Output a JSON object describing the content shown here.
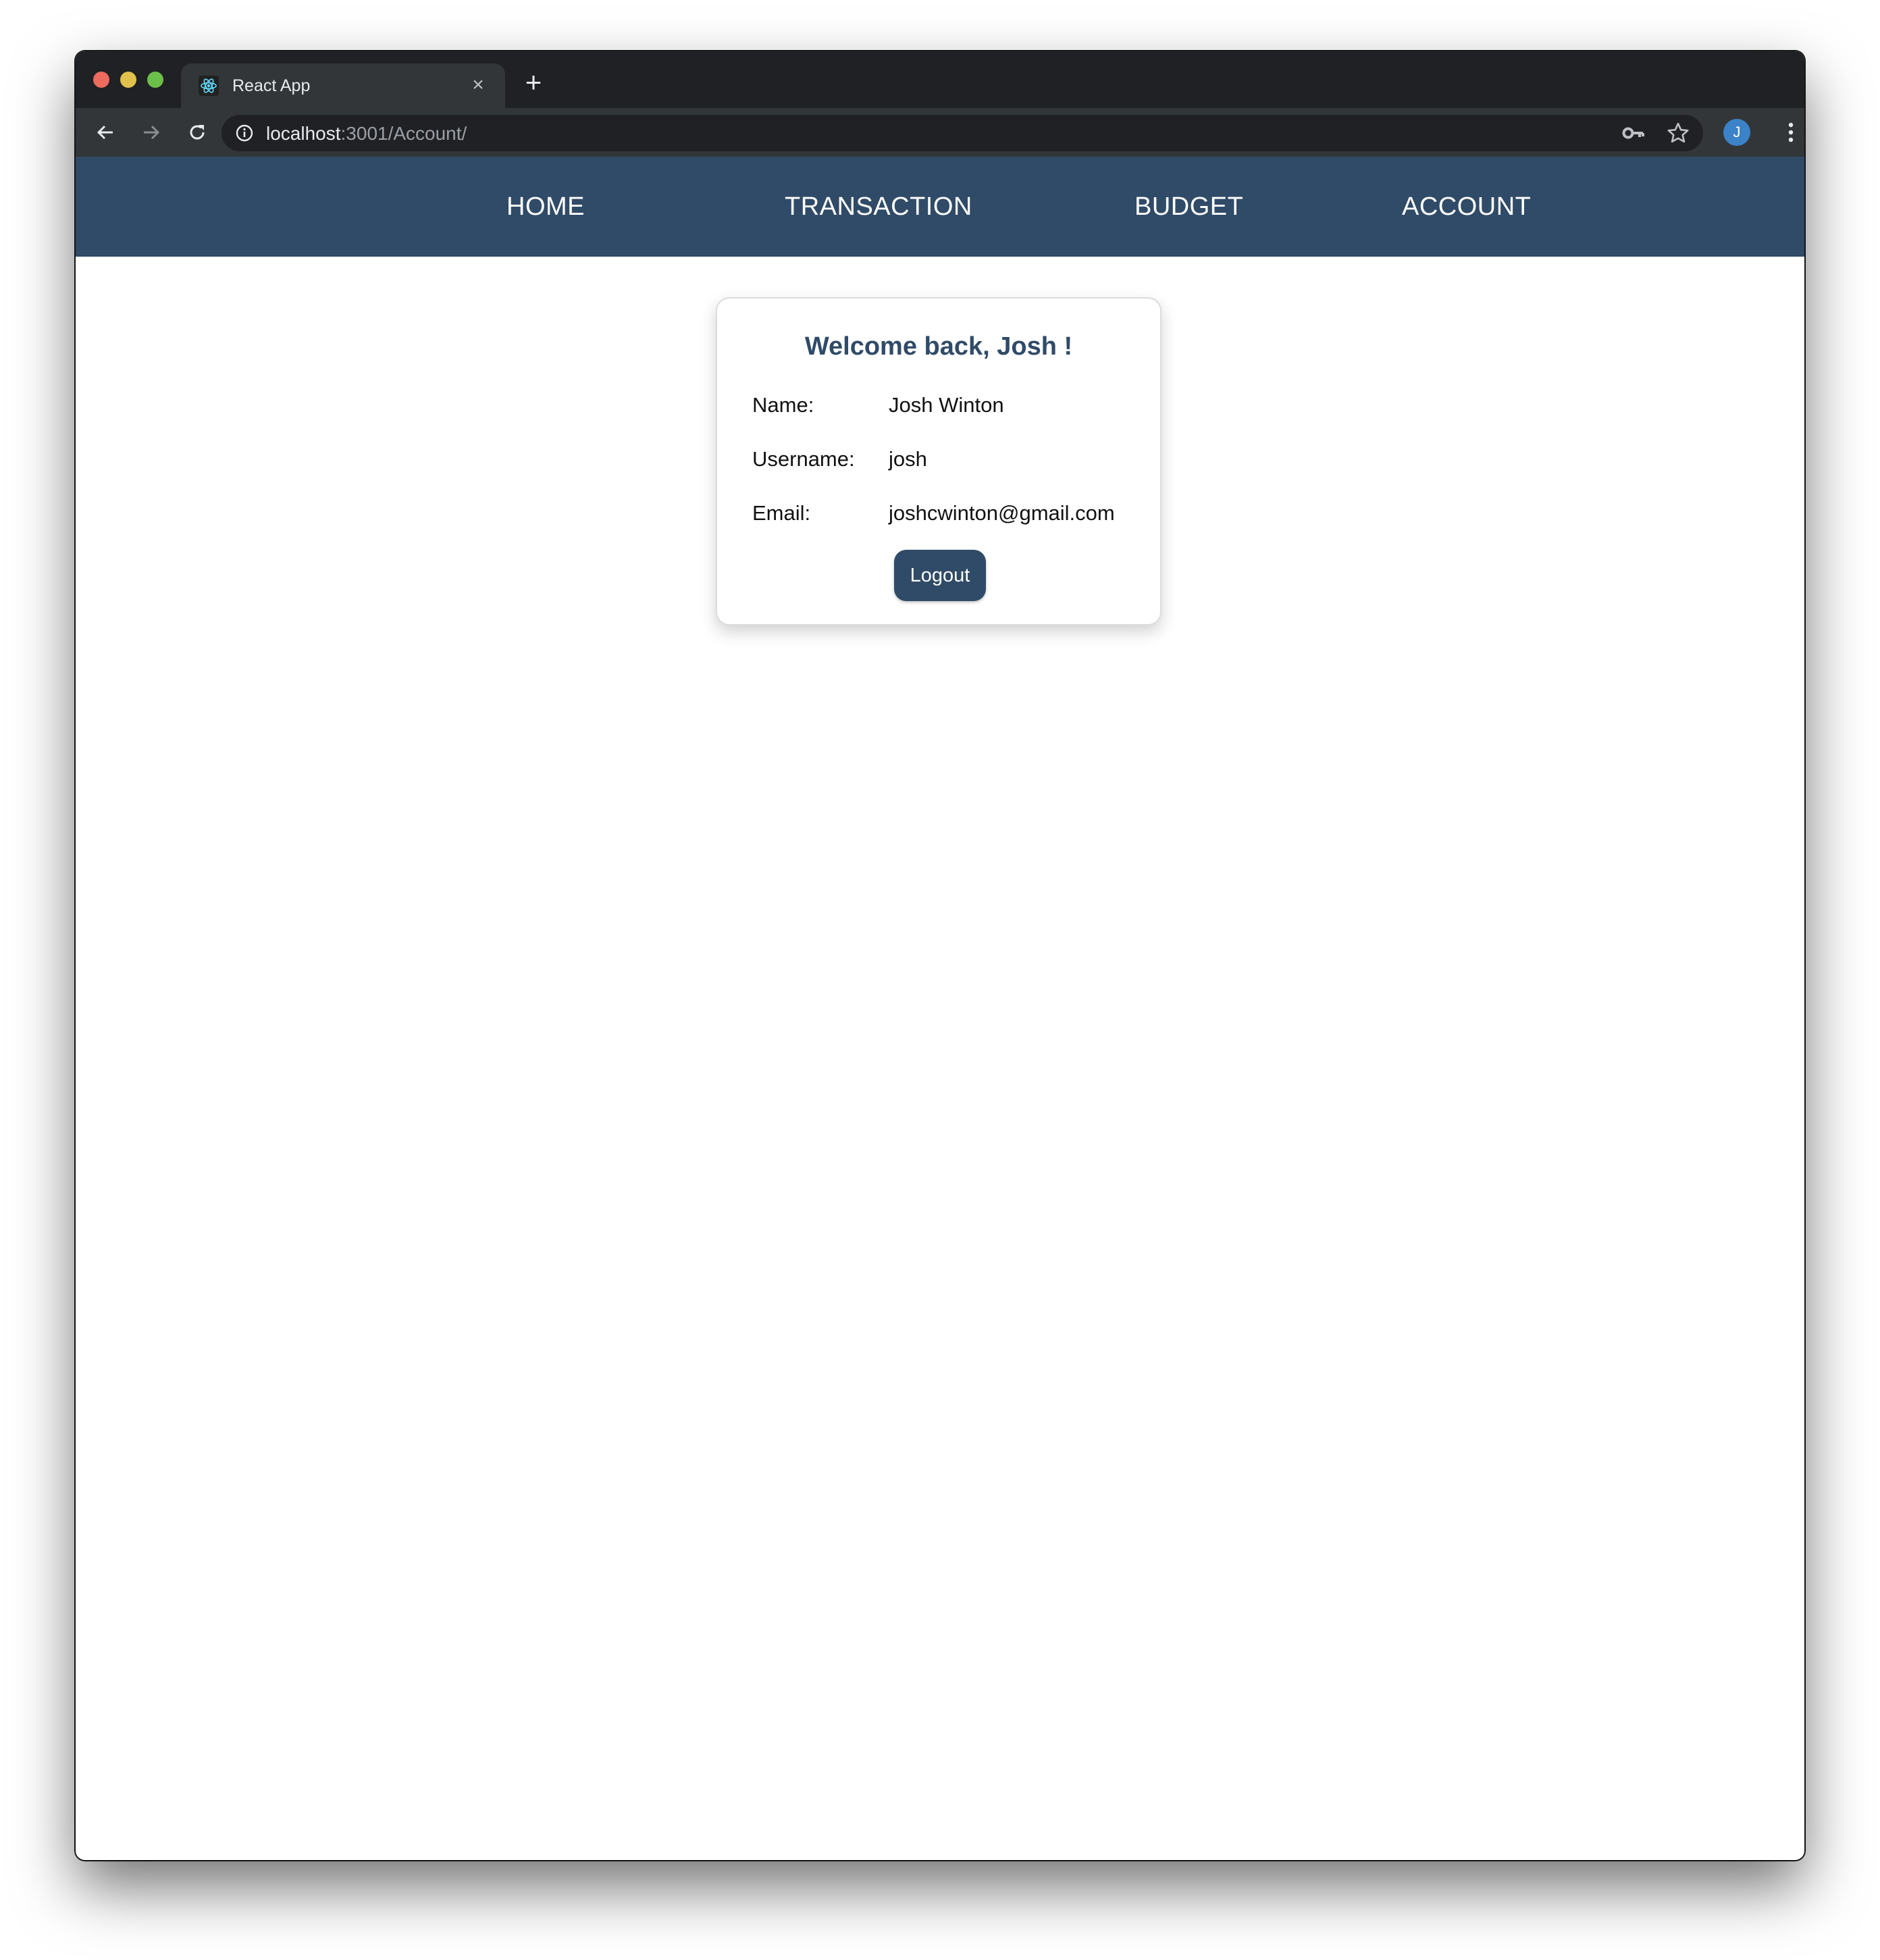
{
  "browser": {
    "tab_title": "React App",
    "url_host": "localhost",
    "url_rest": ":3001/Account/",
    "profile_initial": "J",
    "icons": {
      "favicon": "react-logo-icon",
      "close": "close-icon",
      "new_tab": "plus-icon",
      "back": "arrow-left-icon",
      "forward": "arrow-right-icon",
      "reload": "reload-icon",
      "site_info": "info-icon",
      "passwords": "key-icon",
      "bookmark": "star-icon",
      "menu": "vertical-dots-icon"
    }
  },
  "nav": {
    "items": [
      {
        "label": "HOME"
      },
      {
        "label": "TRANSACTION"
      },
      {
        "label": "BUDGET"
      },
      {
        "label": "ACCOUNT"
      }
    ]
  },
  "account": {
    "heading": "Welcome back, Josh !",
    "fields": [
      {
        "label": "Name:",
        "value": "Josh Winton"
      },
      {
        "label": "Username:",
        "value": "josh"
      },
      {
        "label": "Email:",
        "value": "joshcwinton@gmail.com"
      }
    ],
    "logout_label": "Logout"
  },
  "colors": {
    "brand": "#304b67",
    "browser_frame": "#202124",
    "toolbar": "#323639",
    "avatar": "#3b82c8"
  }
}
